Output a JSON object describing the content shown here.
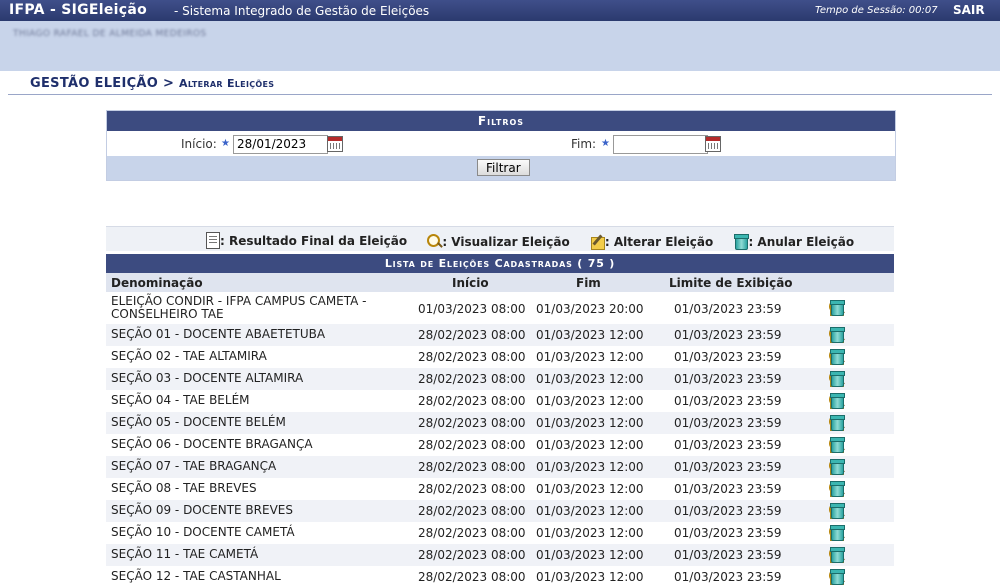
{
  "header": {
    "app_name": "IFPA - SIGEleição",
    "subtitle": "- Sistema Integrado de Gestão de Eleições",
    "session_label": "Tempo de Sessão: 00:07",
    "logout": "SAIR"
  },
  "user": {
    "name": "THIAGO RAFAEL DE ALMEIDA MEDEIROS"
  },
  "breadcrumb": {
    "section": "GESTÃO ELEIÇÃO",
    "separator": ">",
    "page": "Alterar Eleições"
  },
  "filters": {
    "title": "Filtros",
    "inicio_label": "Início:",
    "inicio_value": "28/01/2023",
    "fim_label": "Fim:",
    "fim_value": "",
    "submit": "Filtrar"
  },
  "legend": {
    "resultado": ": Resultado Final da Eleição",
    "visualizar": ": Visualizar Eleição",
    "alterar": ": Alterar Eleição",
    "anular": ": Anular Eleição"
  },
  "list": {
    "title": "Lista de Eleições Cadastradas ( 75 )",
    "columns": {
      "denominacao": "Denominação",
      "inicio": "Início",
      "fim": "Fim",
      "limite": "Limite de Exibição"
    },
    "rows": [
      {
        "den": "ELEIÇÃO CONDIR - IFPA CAMPUS CAMETA - CONSELHEIRO TAE",
        "ini": "01/03/2023 08:00",
        "fim": "01/03/2023 20:00",
        "lim": "01/03/2023 23:59"
      },
      {
        "den": "SEÇÃO 01 - DOCENTE ABAETETUBA",
        "ini": "28/02/2023 08:00",
        "fim": "01/03/2023 12:00",
        "lim": "01/03/2023 23:59"
      },
      {
        "den": "SEÇÃO 02 - TAE ALTAMIRA",
        "ini": "28/02/2023 08:00",
        "fim": "01/03/2023 12:00",
        "lim": "01/03/2023 23:59"
      },
      {
        "den": "SEÇÃO 03 - DOCENTE ALTAMIRA",
        "ini": "28/02/2023 08:00",
        "fim": "01/03/2023 12:00",
        "lim": "01/03/2023 23:59"
      },
      {
        "den": "SEÇÃO 04 - TAE BELÉM",
        "ini": "28/02/2023 08:00",
        "fim": "01/03/2023 12:00",
        "lim": "01/03/2023 23:59"
      },
      {
        "den": "SEÇÃO 05 - DOCENTE BELÉM",
        "ini": "28/02/2023 08:00",
        "fim": "01/03/2023 12:00",
        "lim": "01/03/2023 23:59"
      },
      {
        "den": "SEÇÃO 06 - DOCENTE BRAGANÇA",
        "ini": "28/02/2023 08:00",
        "fim": "01/03/2023 12:00",
        "lim": "01/03/2023 23:59"
      },
      {
        "den": "SEÇÃO 07 - TAE BRAGANÇA",
        "ini": "28/02/2023 08:00",
        "fim": "01/03/2023 12:00",
        "lim": "01/03/2023 23:59"
      },
      {
        "den": "SEÇÃO 08 - TAE BREVES",
        "ini": "28/02/2023 08:00",
        "fim": "01/03/2023 12:00",
        "lim": "01/03/2023 23:59"
      },
      {
        "den": "SEÇÃO 09 - DOCENTE BREVES",
        "ini": "28/02/2023 08:00",
        "fim": "01/03/2023 12:00",
        "lim": "01/03/2023 23:59"
      },
      {
        "den": "SEÇÃO 10 - DOCENTE CAMETÁ",
        "ini": "28/02/2023 08:00",
        "fim": "01/03/2023 12:00",
        "lim": "01/03/2023 23:59"
      },
      {
        "den": "SEÇÃO 11 - TAE CAMETÁ",
        "ini": "28/02/2023 08:00",
        "fim": "01/03/2023 12:00",
        "lim": "01/03/2023 23:59"
      },
      {
        "den": "SEÇÃO 12 - TAE CASTANHAL",
        "ini": "28/02/2023 08:00",
        "fim": "01/03/2023 12:00",
        "lim": "01/03/2023 23:59"
      }
    ]
  }
}
